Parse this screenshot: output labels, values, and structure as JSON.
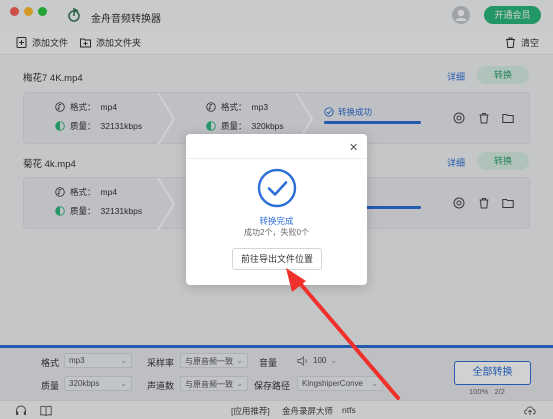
{
  "app": {
    "title": "金舟音频转换器",
    "vip_label": "开通会员"
  },
  "toolbar": {
    "add_file": "添加文件",
    "add_folder": "添加文件夹",
    "clear": "清空"
  },
  "tasks": [
    {
      "name": "梅花7 4K.mp4",
      "detail": "详细",
      "convert": "转换",
      "input_format_label": "格式：",
      "input_format": "mp4",
      "input_quality_label": "质量：",
      "input_quality": "32131kbps",
      "output_format_label": "格式：",
      "output_format": "mp3",
      "output_quality_label": "质量：",
      "output_quality": "320kbps",
      "status": "转换成功",
      "progress": 1.0
    },
    {
      "name": "菊花 4k.mp4",
      "detail": "详细",
      "convert": "转换",
      "input_format_label": "格式：",
      "input_format": "mp4",
      "input_quality_label": "质量：",
      "input_quality": "32131kbps",
      "progress": 1.0
    }
  ],
  "settings": {
    "format_label": "格式",
    "format_value": "mp3",
    "quality_label": "质量",
    "quality_value": "320kbps",
    "sample_rate_label": "采样率",
    "sample_rate_value": "与原音频一致",
    "channels_label": "声道数",
    "channels_value": "与原音频一致",
    "volume_label": "音量",
    "volume_value": "100",
    "save_path_label": "保存路径",
    "save_path_value": "KingshiperConve",
    "convert_all": "全部转换",
    "progress_percent": "100%",
    "progress_count": "2/2"
  },
  "statusbar": {
    "recommend": "[应用推荐]",
    "app_name": "金舟录屏大师",
    "fs": "ntfs"
  },
  "modal": {
    "title": "转换完成",
    "subtitle": "成功2个，失败0个",
    "button": "前往导出文件位置"
  },
  "colors": {
    "accent": "#2d6fd6",
    "green": "#2bb77d",
    "arrow": "#f0302a"
  }
}
